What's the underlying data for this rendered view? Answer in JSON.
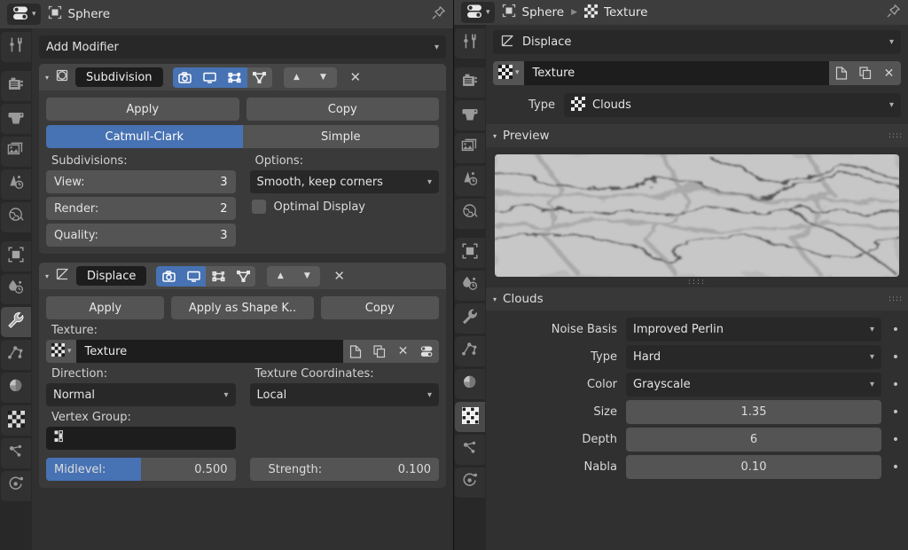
{
  "accent": "#4772b3",
  "left_editor": {
    "header": {
      "editor_type_icon": "properties-editor-icon",
      "object_icon": "object-data-icon",
      "title": "Sphere",
      "pin_icon": "pin-icon"
    },
    "tabs": [
      {
        "name": "tool",
        "icon": "tool-icon",
        "active": false
      },
      {
        "name": "render",
        "icon": "camera-back-icon",
        "active": false
      },
      {
        "name": "output",
        "icon": "printer-icon",
        "active": false
      },
      {
        "name": "view-layer",
        "icon": "images-icon",
        "active": false
      },
      {
        "name": "scene",
        "icon": "scene-cone-icon",
        "active": false
      },
      {
        "name": "world",
        "icon": "world-globe-icon",
        "active": false
      },
      {
        "name": "object",
        "icon": "object-square-icon",
        "active": false
      },
      {
        "name": "modifiers-physics",
        "icon": "teardrop-icon",
        "active": false
      },
      {
        "name": "modifiers",
        "icon": "wrench-icon",
        "active": true
      },
      {
        "name": "particles",
        "icon": "particles-icon",
        "active": false
      },
      {
        "name": "material",
        "icon": "material-sphere-icon",
        "active": false
      },
      {
        "name": "texture",
        "icon": "checker-icon",
        "active": false
      },
      {
        "name": "constraints",
        "icon": "constraint-icon",
        "active": false
      },
      {
        "name": "physics",
        "icon": "physics-orbit-icon",
        "active": false
      }
    ],
    "add_modifier": {
      "label": "Add Modifier",
      "arrow": "chevron-down-icon"
    },
    "modifiers": [
      {
        "expand_icon": "triangle-down-icon",
        "type_icon": "subdivision-icon",
        "name": "Subdivision",
        "toggles": [
          {
            "name": "render-toggle",
            "icon": "camera-icon",
            "on": true
          },
          {
            "name": "realtime-toggle",
            "icon": "monitor-icon",
            "on": true
          },
          {
            "name": "edit-mode-toggle",
            "icon": "editmode-icon",
            "on": true
          },
          {
            "name": "on-cage-toggle",
            "icon": "cage-icon",
            "on": false
          }
        ],
        "move_up": "triangle-up-icon",
        "move_down": "triangle-down-icon",
        "close": "close-icon",
        "buttons": [
          {
            "name": "apply-button",
            "label": "Apply"
          },
          {
            "name": "copy-button",
            "label": "Copy"
          }
        ],
        "algorithm": [
          {
            "name": "catmull-clark-button",
            "label": "Catmull-Clark",
            "active": true
          },
          {
            "name": "simple-button",
            "label": "Simple",
            "active": false
          }
        ],
        "subdivisions_label": "Subdivisions:",
        "options_label": "Options:",
        "fields": [
          {
            "name": "view-field",
            "label": "View:",
            "value": "3"
          },
          {
            "name": "render-field",
            "label": "Render:",
            "value": "2"
          },
          {
            "name": "quality-field",
            "label": "Quality:",
            "value": "3"
          }
        ],
        "uv_smooth": "Smooth, keep corners",
        "optimal_display": {
          "label": "Optimal Display",
          "checked": false
        }
      },
      {
        "expand_icon": "triangle-down-icon",
        "type_icon": "displace-icon",
        "name": "Displace",
        "toggles": [
          {
            "name": "render-toggle",
            "icon": "camera-icon",
            "on": true
          },
          {
            "name": "realtime-toggle",
            "icon": "monitor-icon",
            "on": true
          },
          {
            "name": "edit-mode-toggle",
            "icon": "editmode-icon",
            "on": false
          },
          {
            "name": "on-cage-toggle",
            "icon": "cage-icon",
            "on": false
          }
        ],
        "move_up": "triangle-up-icon",
        "move_down": "triangle-down-icon",
        "close": "close-icon",
        "buttons": [
          {
            "name": "apply-button",
            "label": "Apply"
          },
          {
            "name": "apply-as-shape-key-button",
            "label": "Apply as Shape K.."
          },
          {
            "name": "copy-button",
            "label": "Copy"
          }
        ],
        "texture_label": "Texture:",
        "texture_id": {
          "browse_icon": "checker-icon",
          "browse_arrow": "chevron-down-icon",
          "name": "Texture",
          "new_icon": "new-data-icon",
          "copy_icon": "duplicate-icon",
          "unlink_icon": "close-icon",
          "props_icon": "properties-editor-icon"
        },
        "direction_label": "Direction:",
        "direction_value": "Normal",
        "texcoord_label": "Texture Coordinates:",
        "texcoord_value": "Local",
        "vertex_group_label": "Vertex Group:",
        "vertex_group_icon": "vertex-group-icon",
        "vertex_group_value": "",
        "midlevel": {
          "label": "Midlevel:",
          "value": "0.500",
          "fill_percent": 50
        },
        "strength": {
          "label": "Strength:",
          "value": "0.100"
        }
      }
    ]
  },
  "right_editor": {
    "header": {
      "editor_type_icon": "properties-editor-icon",
      "object_icon": "object-data-icon",
      "object_name": "Sphere",
      "separator_icon": "chevron-right-icon",
      "texture_icon": "checker-icon",
      "texture_name": "Texture",
      "pin_icon": "pin-icon"
    },
    "tabs": [
      {
        "name": "tool",
        "icon": "tool-icon",
        "active": false
      },
      {
        "name": "render",
        "icon": "camera-back-icon",
        "active": false
      },
      {
        "name": "output",
        "icon": "printer-icon",
        "active": false
      },
      {
        "name": "view-layer",
        "icon": "images-icon",
        "active": false
      },
      {
        "name": "scene",
        "icon": "scene-cone-icon",
        "active": false
      },
      {
        "name": "world",
        "icon": "world-globe-icon",
        "active": false
      },
      {
        "name": "object",
        "icon": "object-square-icon",
        "active": false
      },
      {
        "name": "modifiers-physics",
        "icon": "teardrop-icon",
        "active": false
      },
      {
        "name": "modifiers",
        "icon": "wrench-icon",
        "active": false
      },
      {
        "name": "particles",
        "icon": "particles-icon",
        "active": false
      },
      {
        "name": "material",
        "icon": "material-sphere-icon",
        "active": false
      },
      {
        "name": "texture",
        "icon": "checker-icon",
        "active": true
      },
      {
        "name": "constraints",
        "icon": "constraint-icon",
        "active": false
      },
      {
        "name": "physics",
        "icon": "physics-orbit-icon",
        "active": false
      }
    ],
    "context_selector": {
      "icon": "displace-icon",
      "label": "Displace",
      "arrow": "chevron-down-icon"
    },
    "texture_id": {
      "browse_icon": "checker-icon",
      "browse_arrow": "chevron-down-icon",
      "name": "Texture",
      "new_icon": "new-data-icon",
      "copy_icon": "duplicate-icon",
      "unlink_icon": "close-icon"
    },
    "type_row": {
      "label": "Type",
      "icon": "checker-icon",
      "value": "Clouds",
      "arrow": "chevron-down-icon"
    },
    "preview_section": {
      "title": "Preview",
      "tri": "triangle-down-icon",
      "grip": "grip-icon"
    },
    "clouds_section": {
      "title": "Clouds",
      "tri": "triangle-down-icon",
      "grip": "grip-icon",
      "properties": [
        {
          "name": "noise-basis",
          "label": "Noise Basis",
          "value": "Improved Perlin",
          "widget": "dropdown",
          "animate_dot": "•"
        },
        {
          "name": "type",
          "label": "Type",
          "value": "Hard",
          "widget": "dropdown",
          "animate_dot": "•"
        },
        {
          "name": "color",
          "label": "Color",
          "value": "Grayscale",
          "widget": "dropdown",
          "animate_dot": "•"
        },
        {
          "name": "size",
          "label": "Size",
          "value": "1.35",
          "widget": "slider",
          "animate_dot": "•"
        },
        {
          "name": "depth",
          "label": "Depth",
          "value": "6",
          "widget": "slider",
          "animate_dot": "•"
        },
        {
          "name": "nabla",
          "label": "Nabla",
          "value": "0.10",
          "widget": "slider",
          "animate_dot": "•"
        }
      ]
    }
  }
}
